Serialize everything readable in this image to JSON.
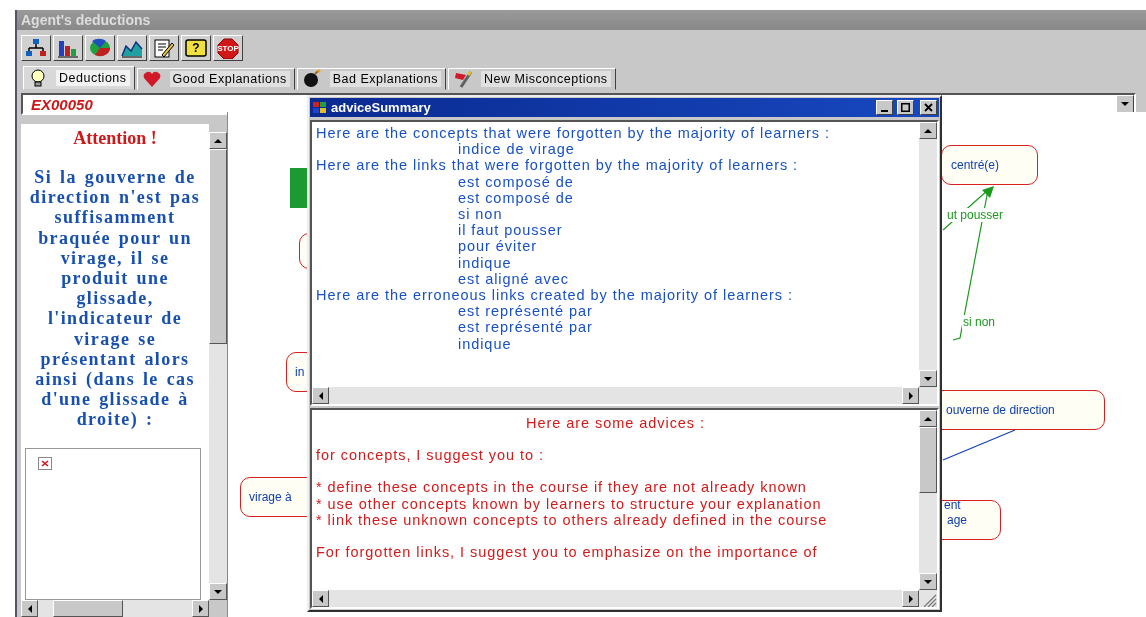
{
  "window": {
    "title": "Agent's deductions"
  },
  "toolbar": [
    {
      "kind": "hierarchy"
    },
    {
      "kind": "bars"
    },
    {
      "kind": "pie"
    },
    {
      "kind": "area"
    },
    {
      "kind": "edit"
    },
    {
      "kind": "help",
      "text": "?"
    },
    {
      "kind": "stop",
      "text": "STOP"
    }
  ],
  "tabs": [
    {
      "label": "Deductions",
      "kind": "bulb",
      "selected": true
    },
    {
      "label": "Good Explanations",
      "kind": "heart",
      "selected": false
    },
    {
      "label": "Bad Explanations",
      "kind": "bomb",
      "selected": false
    },
    {
      "label": "New Misconceptions",
      "kind": "flag",
      "selected": false
    }
  ],
  "exercise_selector": {
    "value": "EX00050"
  },
  "explanation_panel": {
    "title": "Attention !",
    "text": "Si la gouverne de direction n'est pas suffisamment braquée pour un virage, il se produit une glissade, l'indicateur de virage se présentant alors ainsi (dans le cas d'une glissade à droite) :"
  },
  "concept_map": {
    "nodes": [
      {
        "kind": "block"
      },
      {
        "kind": "concept"
      },
      {
        "kind": "concept",
        "label": "in"
      },
      {
        "kind": "concept",
        "label": "virage à"
      },
      {
        "kind": "concept",
        "label": "centré(e)"
      },
      {
        "kind": "concept",
        "label": "ouverne de direction"
      },
      {
        "kind": "concept",
        "label": "age"
      }
    ],
    "link_labels": [
      {
        "text": "ut pousser",
        "color": "#1a9a1a"
      },
      {
        "text": "si non",
        "color": "#1a9a1a"
      },
      {
        "text": "ent",
        "color": "#1040b0"
      }
    ]
  },
  "dialog": {
    "title": "adviceSummary",
    "summary_lines": [
      {
        "kind": "heading",
        "text": "Here are the concepts that were forgotten by the majority of learners :"
      },
      {
        "kind": "item",
        "text": "indice de virage"
      },
      {
        "kind": "heading",
        "text": "Here are the links that were forgotten by the majority of learners :"
      },
      {
        "kind": "item",
        "text": "est composé de"
      },
      {
        "kind": "item",
        "text": "est composé de"
      },
      {
        "kind": "item",
        "text": "si non"
      },
      {
        "kind": "item",
        "text": "il faut pousser"
      },
      {
        "kind": "item",
        "text": "pour éviter"
      },
      {
        "kind": "item",
        "text": "indique"
      },
      {
        "kind": "item",
        "text": "est aligné avec"
      },
      {
        "kind": "heading",
        "text": "Here are the erroneous links created by the majority of learners :"
      },
      {
        "kind": "item",
        "text": "est représenté par"
      },
      {
        "kind": "item",
        "text": "est représenté par"
      },
      {
        "kind": "item",
        "text": "indique"
      }
    ],
    "advice_lines": [
      {
        "kind": "title",
        "text": "Here are some advices :"
      },
      {
        "kind": "section",
        "text": "for concepts, I suggest you to :"
      },
      {
        "kind": "bullet",
        "text": "*  define these concepts in the course if they are not already known"
      },
      {
        "kind": "bullet",
        "text": "*  use other concepts known by learners to structure your explanation"
      },
      {
        "kind": "bullet",
        "text": "*  link these unknown concepts to others already defined in the course"
      },
      {
        "kind": "section",
        "text": "For forgotten links, I suggest you to emphasize on the importance of"
      }
    ]
  }
}
